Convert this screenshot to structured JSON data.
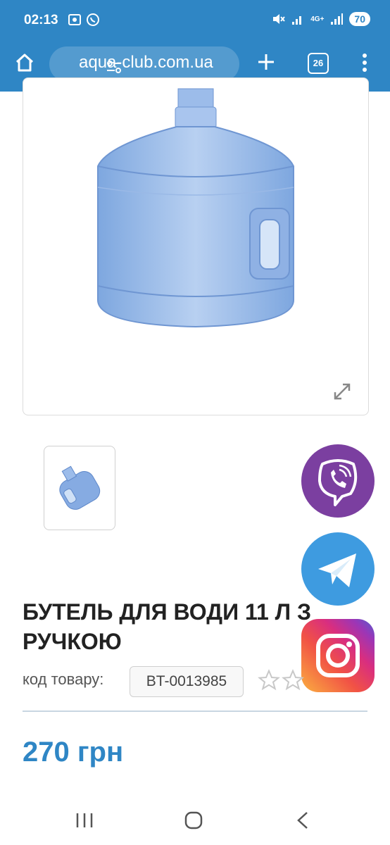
{
  "status_bar": {
    "time": "02:13",
    "battery": "70",
    "network": "4G+"
  },
  "browser": {
    "url": "aqua-club.com.ua",
    "tab_count": "26"
  },
  "product": {
    "title": "БУТЕЛЬ ДЛЯ ВОДИ 11 Л З РУЧКОЮ",
    "code_label": "код товару:",
    "code": "BT-0013985",
    "price": "270 грн",
    "rating_stars": 5,
    "rating_value": 0
  },
  "colors": {
    "accent": "#2f86c5",
    "viber": "#7b3fa0",
    "telegram": "#3e9be0"
  },
  "fabs": [
    "viber-icon",
    "telegram-icon",
    "instagram-icon"
  ]
}
